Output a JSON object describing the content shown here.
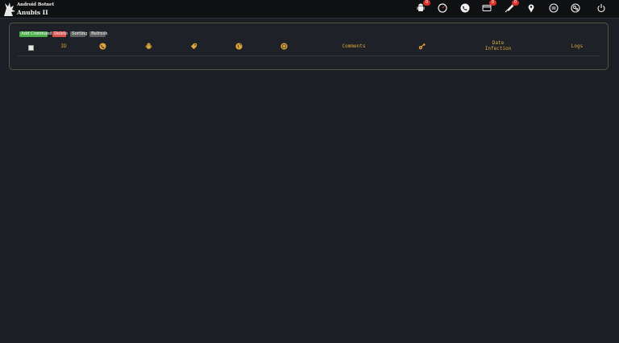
{
  "brand": {
    "line1": "Android Botnet",
    "line2": "Anubis II"
  },
  "nav": [
    {
      "icon": "android-icon",
      "badge": "0"
    },
    {
      "icon": "gauge-icon",
      "badge": ""
    },
    {
      "icon": "phone-icon",
      "badge": ""
    },
    {
      "icon": "credit-card-icon",
      "badge": "0"
    },
    {
      "icon": "syringe-icon",
      "badge": "0"
    },
    {
      "icon": "map-pin-icon",
      "badge": ""
    },
    {
      "icon": "chat-icon",
      "badge": ""
    },
    {
      "icon": "settings-icon",
      "badge": ""
    },
    {
      "icon": "power-icon",
      "badge": ""
    }
  ],
  "toolbar": {
    "add_command": "Add Command",
    "delete": "Delete",
    "sorting": "Sorting",
    "refresh": "Refresh"
  },
  "table": {
    "headers": {
      "id": "ID",
      "comments": "Comments",
      "date_infection_line1": "Date",
      "date_infection_line2": "Infection",
      "logs": "Logs"
    },
    "icon_headers": [
      "phone-icon",
      "android-icon",
      "tag-icon",
      "globe-icon",
      "chip-icon",
      "key-icon"
    ]
  },
  "colors": {
    "accent": "#e0a83a",
    "background": "#1b1e24",
    "add_button": "#4cae4c",
    "delete_button": "#d9534f",
    "neutral_button": "#5f5f5f",
    "badge": "#d9302c"
  }
}
